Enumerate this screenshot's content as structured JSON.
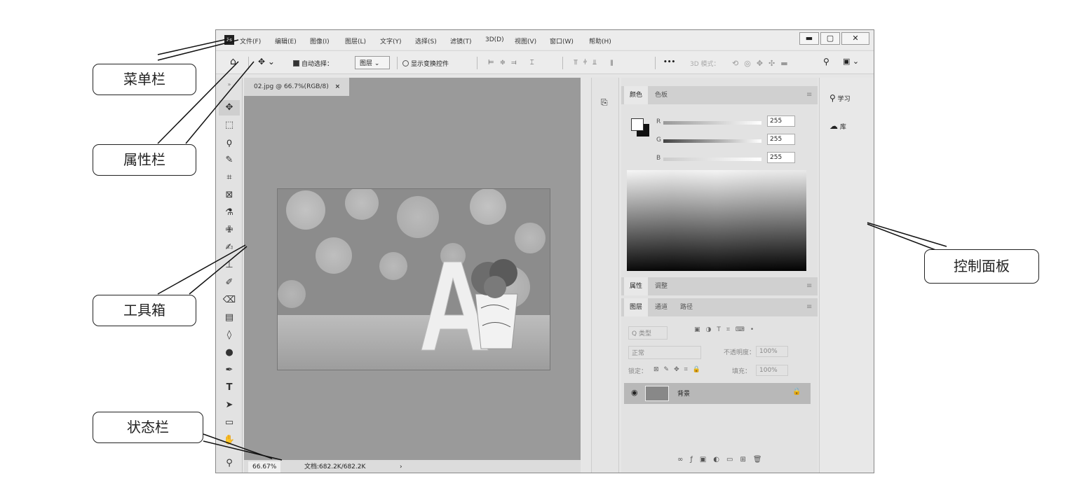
{
  "app": {
    "logo": "Ps"
  },
  "menu": [
    "文件(F)",
    "编辑(E)",
    "图像(I)",
    "图层(L)",
    "文字(Y)",
    "选择(S)",
    "滤镜(T)",
    "3D(D)",
    "视图(V)",
    "窗口(W)",
    "帮助(H)"
  ],
  "window_buttons": {
    "minimize": "▬",
    "maximize": "▢",
    "close": "✕"
  },
  "options_bar": {
    "auto_select_label": "自动选择：",
    "auto_select_value": "图层",
    "show_transform_label": "显示变换控件",
    "more": "•••",
    "mode_3d": "3D 模式："
  },
  "document": {
    "tab_title": "02.jpg @ 66.7%(RGB/8)",
    "tab_close": "×"
  },
  "status": {
    "zoom": "66.67%",
    "doc_info": "文档:682.2K/682.2K",
    "arrow": "›"
  },
  "tools": [
    "move",
    "marquee",
    "lasso",
    "quick-select",
    "crop",
    "frame",
    "eyedropper",
    "healing",
    "brush",
    "stamp",
    "history-brush",
    "eraser",
    "gradient",
    "blur",
    "dodge",
    "pen",
    "type",
    "path-select",
    "rectangle",
    "hand",
    "zoom"
  ],
  "color_panel": {
    "tabs": [
      "颜色",
      "色板"
    ],
    "channels": [
      {
        "name": "R",
        "value": "255"
      },
      {
        "name": "G",
        "value": "255"
      },
      {
        "name": "B",
        "value": "255"
      }
    ]
  },
  "properties_panel": {
    "tabs": [
      "属性",
      "调整"
    ]
  },
  "layers_panel": {
    "tabs": [
      "图层",
      "通道",
      "路径"
    ],
    "filter_label": "Q 类型",
    "blend_mode": "正常",
    "opacity_label": "不透明度：",
    "opacity_value": "100%",
    "lock_label": "锁定：",
    "fill_label": "填充：",
    "fill_value": "100%",
    "layer_name": "背景"
  },
  "side_panel": {
    "learn": "学习",
    "library": "库"
  },
  "callouts": {
    "menu_bar": "菜单栏",
    "options_bar": "属性栏",
    "toolbox": "工具箱",
    "status_bar": "状态栏",
    "control_panel": "控制面板"
  }
}
